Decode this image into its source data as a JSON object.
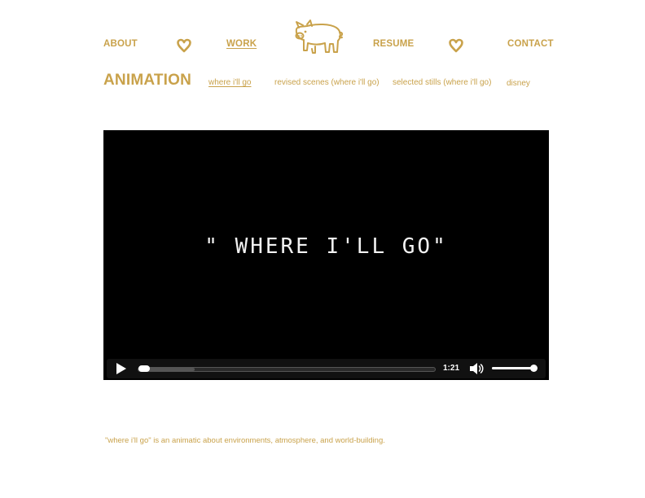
{
  "nav": {
    "about": "ABOUT",
    "work": "WORK",
    "resume": "RESUME",
    "contact": "CONTACT",
    "active": "work"
  },
  "section": {
    "title": "ANIMATION",
    "links": [
      {
        "label": "where i'll go",
        "active": true
      },
      {
        "label": "revised scenes (where i'll go)",
        "active": false
      },
      {
        "label": "selected stills (where i'll go)",
        "active": false
      },
      {
        "label": "disney",
        "active": false
      }
    ]
  },
  "video": {
    "title_card": "\" WHERE I'LL GO\"",
    "duration": "1:21",
    "played_fraction": 0.0,
    "buffered_fraction": 0.19,
    "volume_fraction": 0.95
  },
  "caption": "\"where i'll go\" is an animatic about environments, atmosphere, and world-building.",
  "icons": {
    "logo": "pig-logo-icon",
    "separator": "heart-icon",
    "play": "play-icon",
    "volume": "speaker-icon"
  },
  "colors": {
    "accent": "#c9a24b",
    "video_bg": "#000000",
    "controls_bg": "#111111"
  }
}
